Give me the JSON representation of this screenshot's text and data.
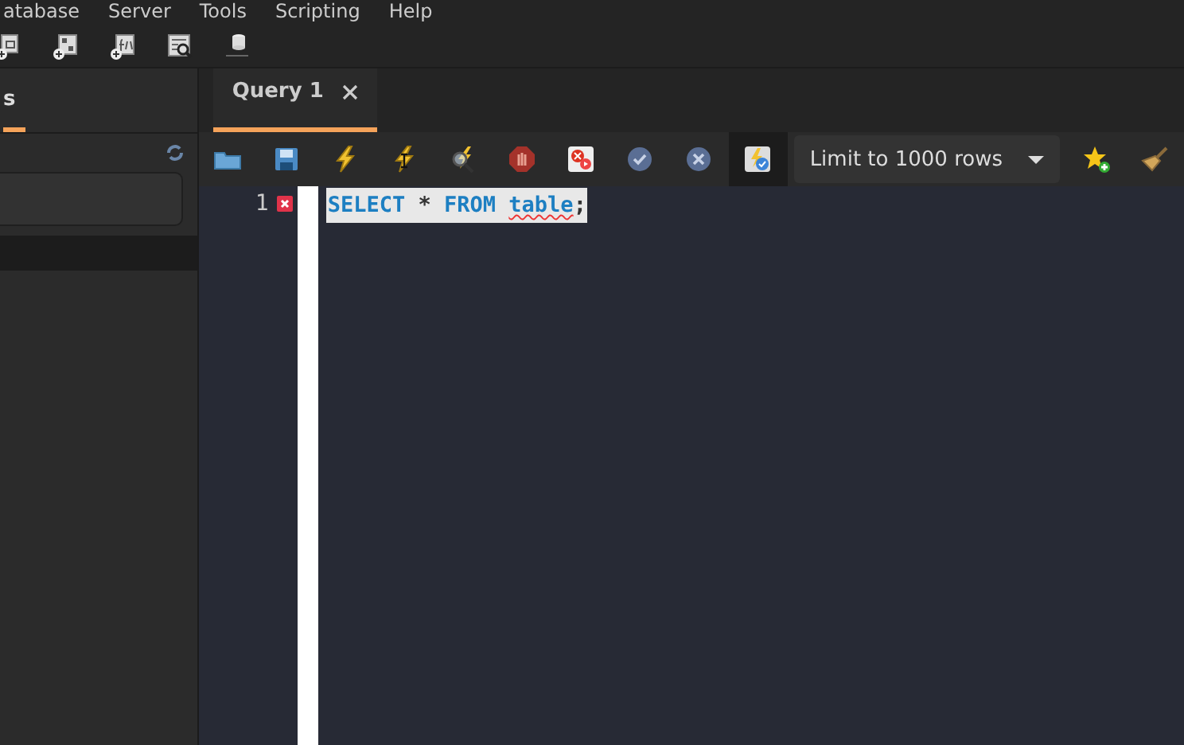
{
  "menu": [
    "atabase",
    "Server",
    "Tools",
    "Scripting",
    "Help"
  ],
  "main_toolbar": [
    {
      "kind": "new-view"
    },
    {
      "kind": "new-routine"
    },
    {
      "kind": "new-function"
    },
    {
      "kind": "inspector"
    },
    {
      "kind": "database"
    }
  ],
  "sidebar": {
    "tabs": [
      {
        "label": "s",
        "selected": true
      }
    ]
  },
  "editor_tabs": [
    {
      "label": "Query 1",
      "selected": true
    }
  ],
  "sql_toolbar": {
    "buttons": [
      {
        "kind": "folder",
        "pressed": false
      },
      {
        "kind": "save",
        "pressed": false
      },
      {
        "kind": "bolt",
        "pressed": false
      },
      {
        "kind": "bolt-cursor",
        "pressed": false
      },
      {
        "kind": "explain",
        "pressed": false
      },
      {
        "kind": "stop",
        "pressed": false
      },
      {
        "kind": "error-toggle",
        "pressed": false
      },
      {
        "kind": "commit",
        "pressed": false
      },
      {
        "kind": "rollback",
        "pressed": false
      },
      {
        "kind": "autocommit",
        "pressed": true
      }
    ],
    "limit": "Limit to 1000 rows",
    "after": [
      {
        "kind": "star"
      },
      {
        "kind": "broom"
      }
    ]
  },
  "editor": {
    "lines": [
      {
        "number": "1",
        "error": true,
        "selected": true,
        "tokens": [
          {
            "kind": "keyword",
            "text": "SELECT"
          },
          {
            "kind": "operator",
            "text": "*"
          },
          {
            "kind": "keyword",
            "text": "FROM"
          },
          {
            "kind": "misspelled",
            "text": "table"
          },
          {
            "kind": "punct",
            "text": ";"
          }
        ]
      }
    ]
  }
}
